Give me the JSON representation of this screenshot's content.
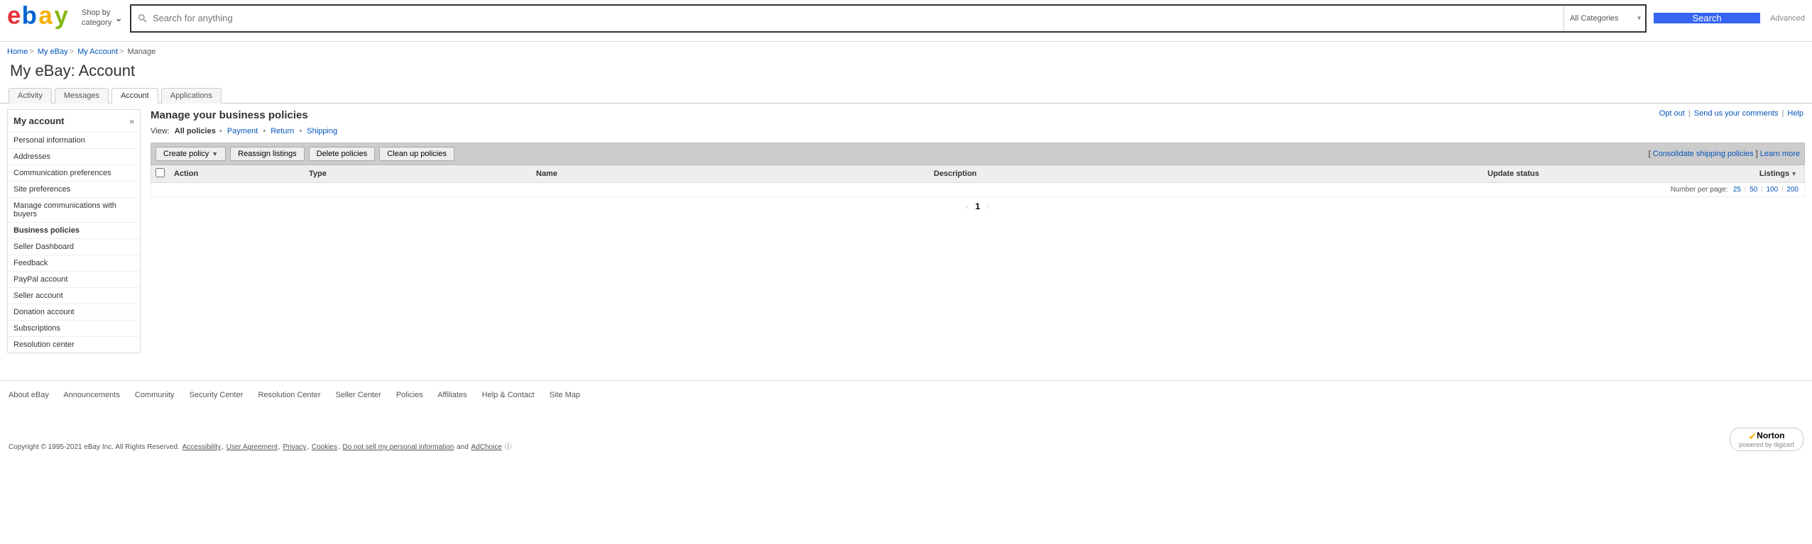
{
  "header": {
    "shopby_l1": "Shop by",
    "shopby_l2": "category",
    "search_placeholder": "Search for anything",
    "cat_label": "All Categories",
    "search_btn": "Search",
    "advanced": "Advanced"
  },
  "breadcrumb": {
    "items": [
      "Home",
      "My eBay",
      "My Account"
    ],
    "current": "Manage"
  },
  "page_title": "My eBay: Account",
  "tabs": {
    "items": [
      "Activity",
      "Messages",
      "Account",
      "Applications"
    ],
    "active_index": 2
  },
  "sidebar": {
    "heading": "My account",
    "collapse_glyph": "«",
    "items": [
      {
        "label": "Personal information",
        "active": false
      },
      {
        "label": "Addresses",
        "active": false
      },
      {
        "label": "Communication preferences",
        "active": false
      },
      {
        "label": "Site preferences",
        "active": false
      },
      {
        "label": "Manage communications with buyers",
        "active": false
      },
      {
        "label": "Business policies",
        "active": true
      },
      {
        "label": "Seller Dashboard",
        "active": false
      },
      {
        "label": "Feedback",
        "active": false
      },
      {
        "label": "PayPal account",
        "active": false
      },
      {
        "label": "Seller account",
        "active": false
      },
      {
        "label": "Donation account",
        "active": false
      },
      {
        "label": "Subscriptions",
        "active": false
      },
      {
        "label": "Resolution center",
        "active": false
      }
    ]
  },
  "main": {
    "title": "Manage your business policies",
    "top_links": {
      "opt_out": "Opt out",
      "send": "Send us your comments",
      "help": "Help"
    },
    "view": {
      "label": "View:",
      "all": "All policies",
      "payment": "Payment",
      "return": "Return",
      "shipping": "Shipping"
    },
    "toolbar": {
      "create": "Create policy",
      "reassign": "Reassign listings",
      "delete": "Delete policies",
      "clean": "Clean up policies",
      "consolidate": "Consolidate shipping policies",
      "learn": "Learn more"
    },
    "columns": {
      "action": "Action",
      "type": "Type",
      "name": "Name",
      "desc": "Description",
      "update": "Update status",
      "listings": "Listings"
    },
    "perpage": {
      "label": "Number per page:",
      "opts": [
        "25",
        "50",
        "100",
        "200"
      ]
    },
    "pager": {
      "current": "1"
    }
  },
  "footer": {
    "links": [
      "About eBay",
      "Announcements",
      "Community",
      "Security Center",
      "Resolution Center",
      "Seller Center",
      "Policies",
      "Affiliates",
      "Help & Contact",
      "Site Map"
    ],
    "copyright": "Copyright © 1995-2021 eBay Inc. All Rights Reserved.",
    "legal": {
      "accessibility": "Accessibility",
      "ua": "User Agreement",
      "privacy": "Privacy",
      "cookies": "Cookies",
      "dns": "Do not sell my personal information",
      "and": "and",
      "adchoice": "AdChoice"
    },
    "norton": {
      "name": "Norton",
      "by": "powered by digicert"
    }
  }
}
